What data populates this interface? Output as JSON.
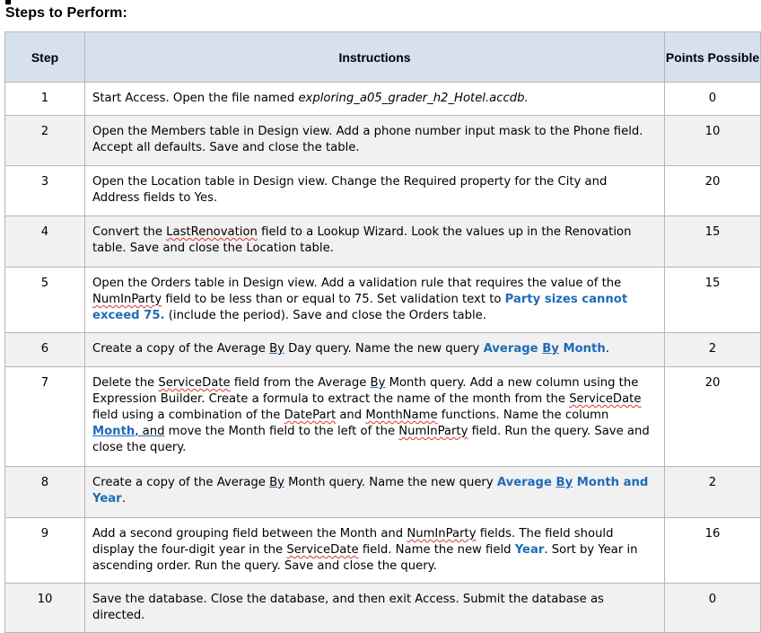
{
  "title": "Steps to Perform:",
  "table": {
    "headers": {
      "step": "Step",
      "instructions": "Instructions",
      "points": "Points Possible"
    },
    "rows": [
      {
        "step": "1",
        "points": "0",
        "parts": [
          {
            "t": "Start Access. Open the file named "
          },
          {
            "t": "exploring_a05_grader_h2_Hotel.accdb.",
            "s": "em"
          }
        ]
      },
      {
        "step": "2",
        "points": "10",
        "parts": [
          {
            "t": "Open the Members table in Design view. Add a phone number input mask to the Phone field. Accept all defaults. Save and close the table."
          }
        ]
      },
      {
        "step": "3",
        "points": "20",
        "parts": [
          {
            "t": "Open the Location table in Design view. Change the Required property for the City and Address fields to Yes."
          }
        ]
      },
      {
        "step": "4",
        "points": "15",
        "parts": [
          {
            "t": "Convert the "
          },
          {
            "t": "LastRenovation",
            "s": "sq"
          },
          {
            "t": " field to a Lookup Wizard. Look the values up in the Renovation table. Save and close the Location table."
          }
        ]
      },
      {
        "step": "5",
        "points": "15",
        "parts": [
          {
            "t": "Open the Orders table in Design view. Add a validation rule that requires the value of the "
          },
          {
            "t": "NumInParty",
            "s": "sq"
          },
          {
            "t": " field to be less than or equal to 75. Set validation text to "
          },
          {
            "t": "Party sizes cannot exceed 75.",
            "s": "hl"
          },
          {
            "t": " (include the period). Save and close the Orders table."
          }
        ]
      },
      {
        "step": "6",
        "points": "2",
        "parts": [
          {
            "t": "Create a copy of the Average "
          },
          {
            "t": "By",
            "s": "ul"
          },
          {
            "t": " Day query. Name the new query "
          },
          {
            "t": "Average ",
            "s": "hl"
          },
          {
            "t": "By",
            "s": "hl ul"
          },
          {
            "t": " Month",
            "s": "hl"
          },
          {
            "t": "."
          }
        ]
      },
      {
        "step": "7",
        "points": "20",
        "parts": [
          {
            "t": "Delete the "
          },
          {
            "t": "ServiceDate",
            "s": "sq"
          },
          {
            "t": " field from the Average "
          },
          {
            "t": "By",
            "s": "ul"
          },
          {
            "t": " Month query. Add a new column using the Expression Builder. Create a formula to extract the name of the month from the "
          },
          {
            "t": "ServiceDate",
            "s": "sq"
          },
          {
            "t": " field using a combination of the "
          },
          {
            "t": "DatePart",
            "s": "sq"
          },
          {
            "t": " and "
          },
          {
            "t": "MonthName",
            "s": "sq"
          },
          {
            "t": " functions. Name the column "
          },
          {
            "t": "Month",
            "s": "hl ul"
          },
          {
            "t": ", and",
            "s": "ul"
          },
          {
            "t": " move the Month field to the left of the "
          },
          {
            "t": "NumInParty",
            "s": "sq"
          },
          {
            "t": " field. Run the query. Save and close the query."
          }
        ]
      },
      {
        "step": "8",
        "points": "2",
        "parts": [
          {
            "t": "Create a copy of the Average "
          },
          {
            "t": "By",
            "s": "ul"
          },
          {
            "t": " Month query. Name the new query "
          },
          {
            "t": "Average ",
            "s": "hl"
          },
          {
            "t": "By",
            "s": "hl ul"
          },
          {
            "t": " Month and Year",
            "s": "hl"
          },
          {
            "t": "."
          }
        ]
      },
      {
        "step": "9",
        "points": "16",
        "parts": [
          {
            "t": "Add a second grouping field between the Month and "
          },
          {
            "t": "NumInParty",
            "s": "sq"
          },
          {
            "t": " fields. The field should display the four-digit year in the "
          },
          {
            "t": "ServiceDate",
            "s": "sq"
          },
          {
            "t": " field. Name the new field "
          },
          {
            "t": "Year",
            "s": "hl"
          },
          {
            "t": ". Sort by Year in ascending order. Run the query. Save and close the query."
          }
        ]
      },
      {
        "step": "10",
        "points": "0",
        "parts": [
          {
            "t": "Save the database. Close the database, and then exit Access. Submit the database as directed."
          }
        ]
      }
    ]
  },
  "colors": {
    "header_bg": "#d6e0ef",
    "alt_row_bg": "#f1f1f1",
    "highlight": "#1f6bb8",
    "border": "#b7b7b7"
  }
}
